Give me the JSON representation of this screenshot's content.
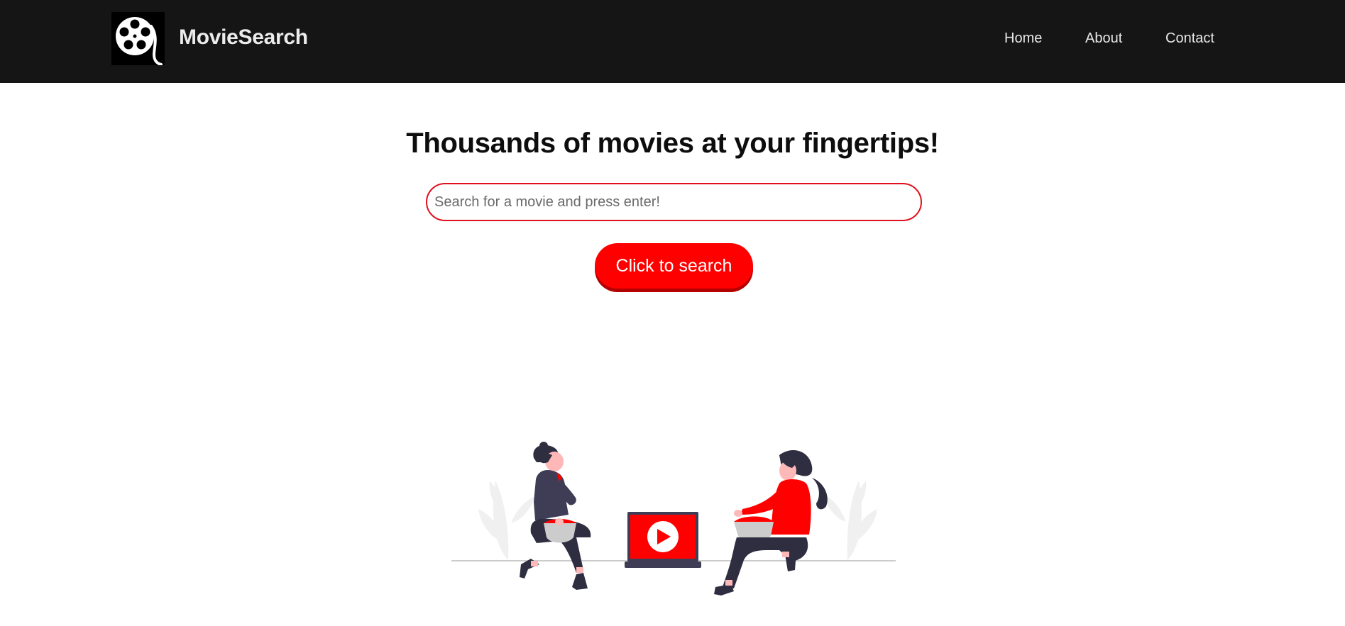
{
  "nav": {
    "brand": "MovieSearch",
    "logo_icon": "film-reel-icon",
    "links": [
      {
        "label": "Home"
      },
      {
        "label": "About"
      },
      {
        "label": "Contact"
      }
    ]
  },
  "hero": {
    "title": "Thousands of movies at your fingertips!",
    "search": {
      "placeholder": "Search for a movie and press enter!",
      "value": ""
    },
    "button_label": "Click to search"
  },
  "illustration": {
    "name": "two-people-watching-laptop-illustration",
    "icons": [
      "play-icon",
      "popcorn-bowl-icon",
      "plant-icon"
    ]
  },
  "colors": {
    "navbar_bg": "#151515",
    "accent": "#ff0000",
    "input_border": "#e0101e",
    "figure_dark": "#3f3d56"
  }
}
